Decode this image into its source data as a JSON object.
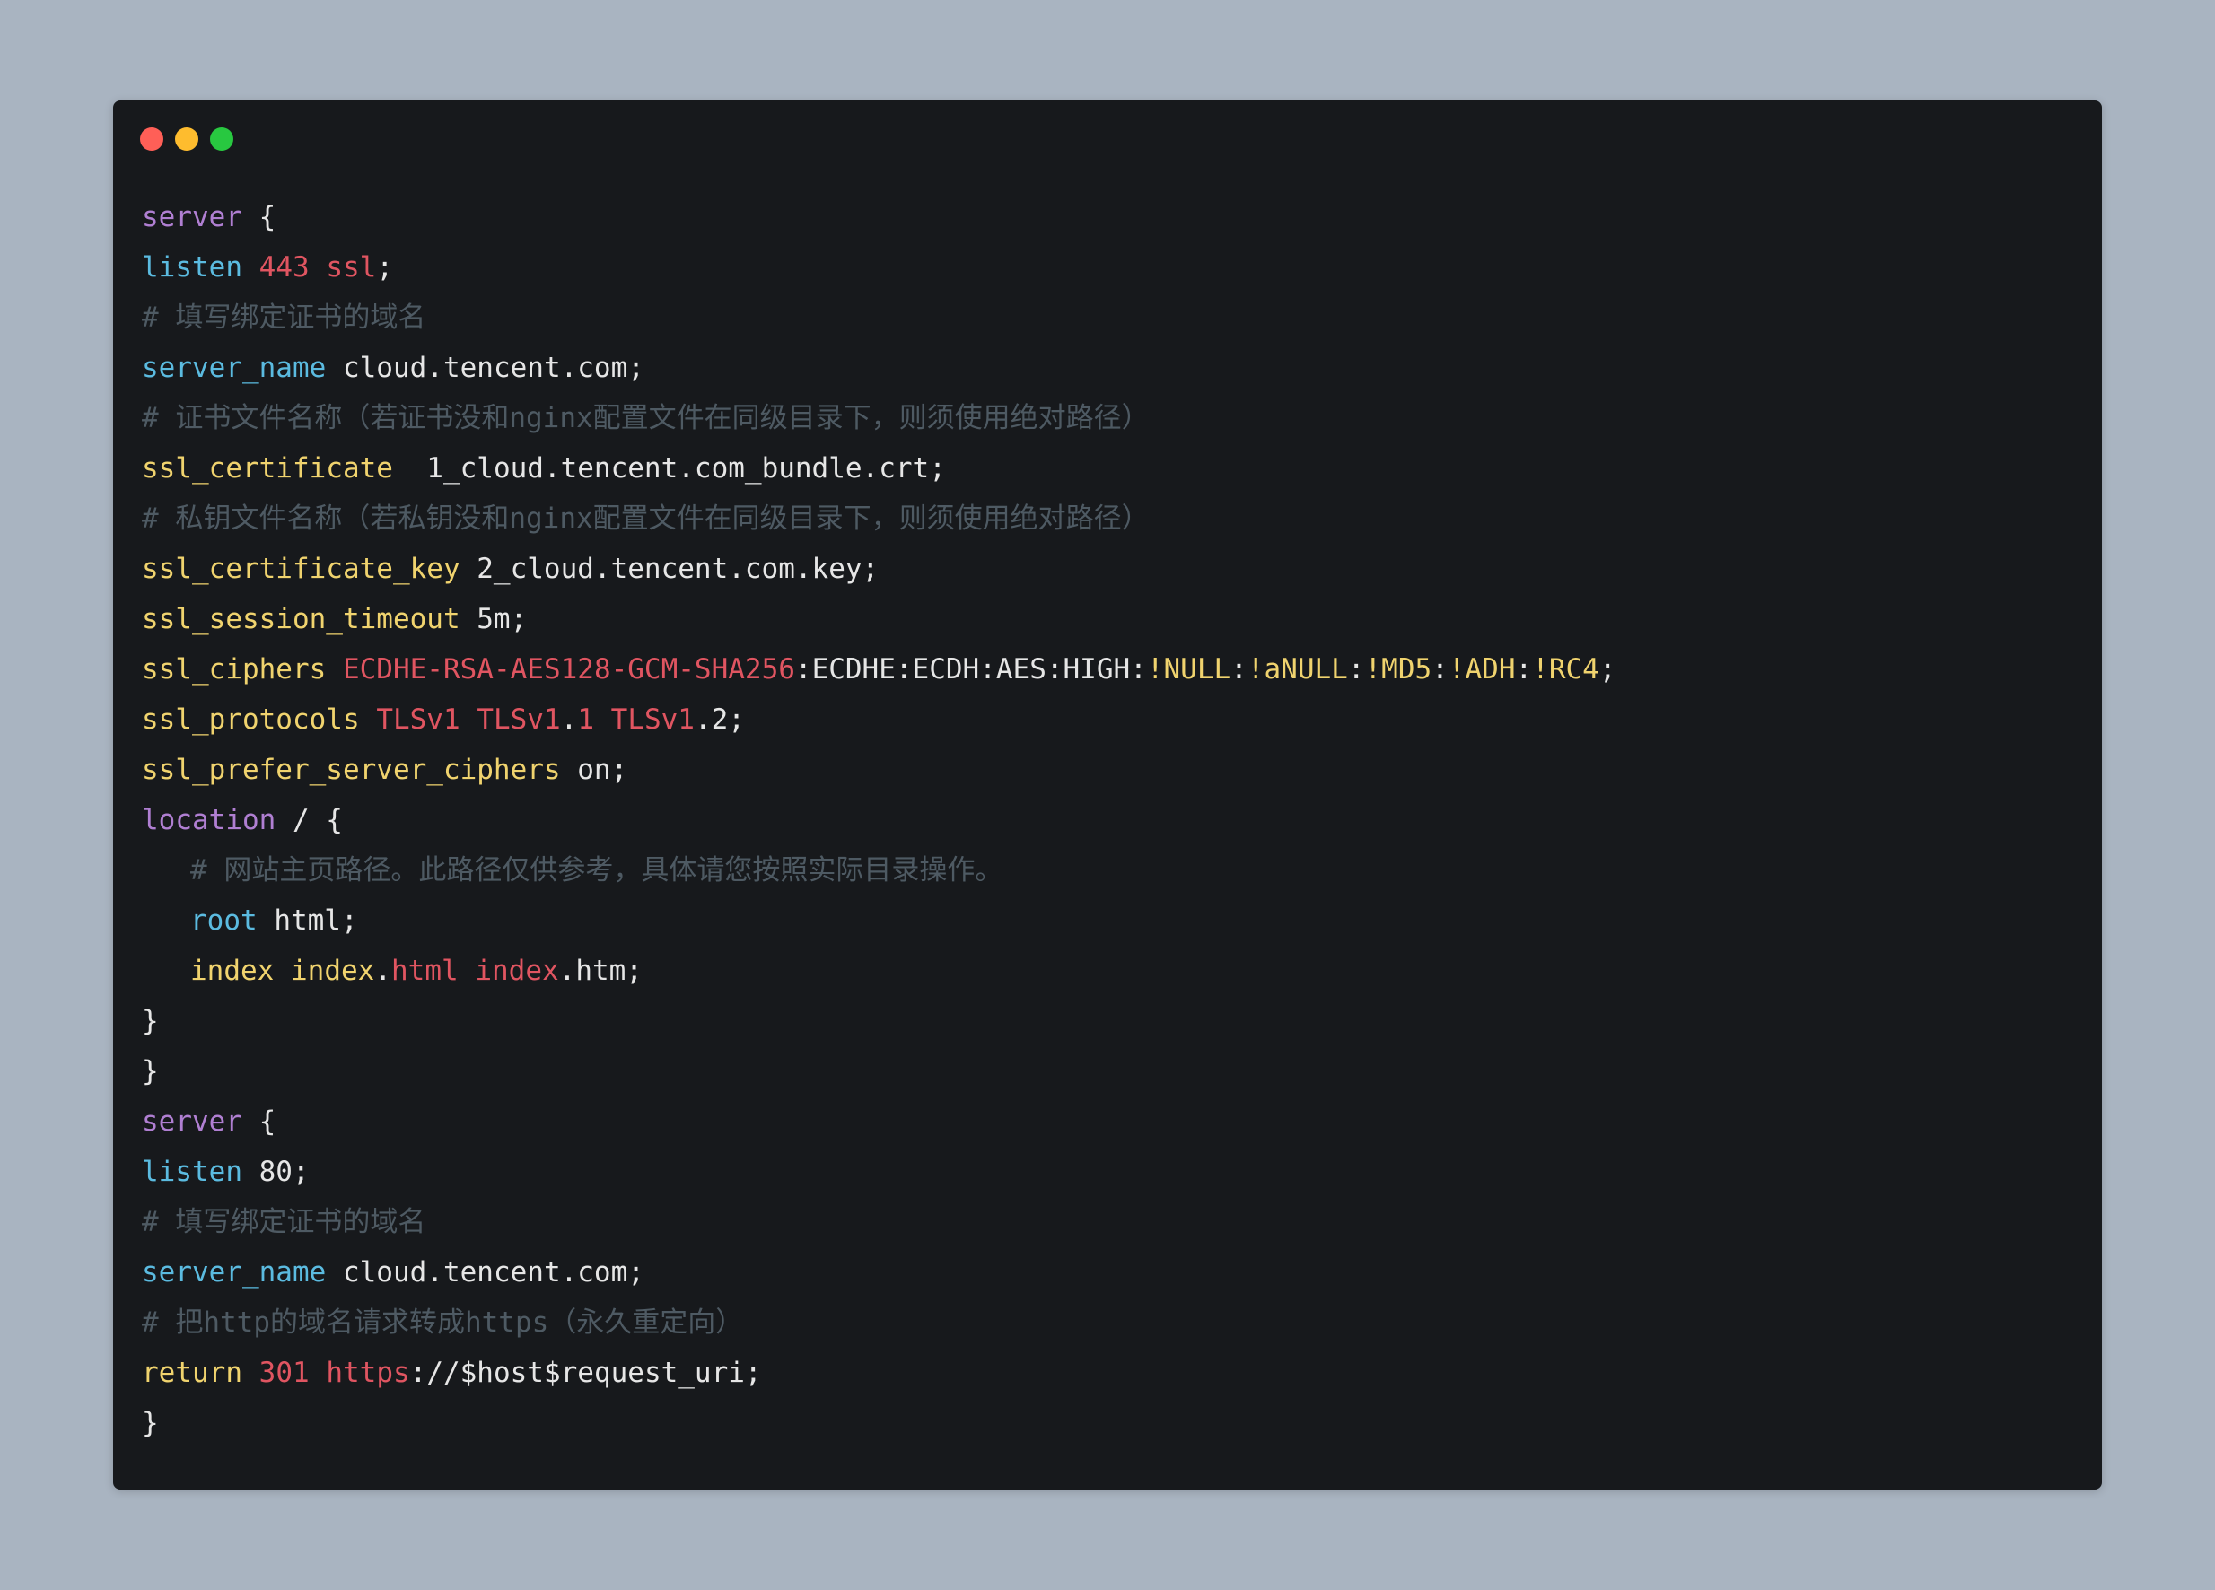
{
  "window": {
    "controls": [
      {
        "name": "close",
        "color": "#ff5f57"
      },
      {
        "name": "minimize",
        "color": "#febc2e"
      },
      {
        "name": "maximize",
        "color": "#28c840"
      }
    ]
  },
  "code": {
    "language": "nginx",
    "lines": [
      {
        "indent": 0,
        "tokens": [
          {
            "t": "server",
            "c": "purple"
          },
          {
            "t": " {",
            "c": "plain"
          }
        ]
      },
      {
        "indent": 0,
        "tokens": [
          {
            "t": "listen",
            "c": "blue"
          },
          {
            "t": " ",
            "c": "plain"
          },
          {
            "t": "443",
            "c": "red"
          },
          {
            "t": " ",
            "c": "plain"
          },
          {
            "t": "ssl",
            "c": "red"
          },
          {
            "t": ";",
            "c": "plain"
          }
        ]
      },
      {
        "indent": 0,
        "tokens": [
          {
            "t": "# 填写绑定证书的域名",
            "c": "comment"
          }
        ]
      },
      {
        "indent": 0,
        "tokens": [
          {
            "t": "server_name",
            "c": "blue"
          },
          {
            "t": " cloud.tencent.com;",
            "c": "plain"
          }
        ]
      },
      {
        "indent": 0,
        "tokens": [
          {
            "t": "# 证书文件名称（若证书没和nginx配置文件在同级目录下，则须使用绝对路径）",
            "c": "comment"
          }
        ]
      },
      {
        "indent": 0,
        "tokens": [
          {
            "t": "ssl_certificate",
            "c": "yellow"
          },
          {
            "t": "  1_cloud.tencent.com_bundle.crt;",
            "c": "plain"
          }
        ]
      },
      {
        "indent": 0,
        "tokens": [
          {
            "t": "# 私钥文件名称（若私钥没和nginx配置文件在同级目录下，则须使用绝对路径）",
            "c": "comment"
          }
        ]
      },
      {
        "indent": 0,
        "tokens": [
          {
            "t": "ssl_certificate_key",
            "c": "yellow"
          },
          {
            "t": " 2_cloud.tencent.com.key;",
            "c": "plain"
          }
        ]
      },
      {
        "indent": 0,
        "tokens": [
          {
            "t": "ssl_session_timeout",
            "c": "yellow"
          },
          {
            "t": " 5m;",
            "c": "plain"
          }
        ]
      },
      {
        "indent": 0,
        "tokens": [
          {
            "t": "ssl_ciphers",
            "c": "yellow"
          },
          {
            "t": " ",
            "c": "plain"
          },
          {
            "t": "ECDHE-RSA-AES128-GCM-SHA256",
            "c": "red"
          },
          {
            "t": ":ECDHE:ECDH:AES:HIGH:",
            "c": "plain"
          },
          {
            "t": "!NULL",
            "c": "yellow"
          },
          {
            "t": ":",
            "c": "plain"
          },
          {
            "t": "!aNULL",
            "c": "yellow"
          },
          {
            "t": ":",
            "c": "plain"
          },
          {
            "t": "!MD5",
            "c": "yellow"
          },
          {
            "t": ":",
            "c": "plain"
          },
          {
            "t": "!ADH",
            "c": "yellow"
          },
          {
            "t": ":",
            "c": "plain"
          },
          {
            "t": "!RC4",
            "c": "yellow"
          },
          {
            "t": ";",
            "c": "plain"
          }
        ]
      },
      {
        "indent": 0,
        "tokens": [
          {
            "t": "ssl_protocols",
            "c": "yellow"
          },
          {
            "t": " ",
            "c": "plain"
          },
          {
            "t": "TLSv1",
            "c": "red"
          },
          {
            "t": " ",
            "c": "plain"
          },
          {
            "t": "TLSv1",
            "c": "red"
          },
          {
            "t": ".",
            "c": "plain"
          },
          {
            "t": "1",
            "c": "red"
          },
          {
            "t": " ",
            "c": "plain"
          },
          {
            "t": "TLSv1",
            "c": "red"
          },
          {
            "t": ".2;",
            "c": "plain"
          }
        ]
      },
      {
        "indent": 0,
        "tokens": [
          {
            "t": "ssl_prefer_server_ciphers",
            "c": "yellow"
          },
          {
            "t": " on;",
            "c": "plain"
          }
        ]
      },
      {
        "indent": 0,
        "tokens": [
          {
            "t": "location",
            "c": "purple"
          },
          {
            "t": " / {",
            "c": "plain"
          }
        ]
      },
      {
        "indent": 1,
        "tokens": [
          {
            "t": "# 网站主页路径。此路径仅供参考，具体请您按照实际目录操作。",
            "c": "comment"
          }
        ]
      },
      {
        "indent": 1,
        "tokens": [
          {
            "t": "root",
            "c": "blue"
          },
          {
            "t": " html;",
            "c": "plain"
          }
        ]
      },
      {
        "indent": 1,
        "tokens": [
          {
            "t": "index",
            "c": "yellow"
          },
          {
            "t": " ",
            "c": "plain"
          },
          {
            "t": "index",
            "c": "yellow"
          },
          {
            "t": ".",
            "c": "plain"
          },
          {
            "t": "html",
            "c": "red"
          },
          {
            "t": " ",
            "c": "plain"
          },
          {
            "t": "index",
            "c": "red"
          },
          {
            "t": ".htm;",
            "c": "plain"
          }
        ]
      },
      {
        "indent": 0,
        "tokens": [
          {
            "t": "}",
            "c": "plain"
          }
        ]
      },
      {
        "indent": 0,
        "tokens": [
          {
            "t": "}",
            "c": "plain"
          }
        ]
      },
      {
        "indent": 0,
        "tokens": [
          {
            "t": "server",
            "c": "purple"
          },
          {
            "t": " {",
            "c": "plain"
          }
        ]
      },
      {
        "indent": 0,
        "tokens": [
          {
            "t": "listen",
            "c": "blue"
          },
          {
            "t": " 80;",
            "c": "plain"
          }
        ]
      },
      {
        "indent": 0,
        "tokens": [
          {
            "t": "# 填写绑定证书的域名",
            "c": "comment"
          }
        ]
      },
      {
        "indent": 0,
        "tokens": [
          {
            "t": "server_name",
            "c": "blue"
          },
          {
            "t": " cloud.tencent.com;",
            "c": "plain"
          }
        ]
      },
      {
        "indent": 0,
        "tokens": [
          {
            "t": "# 把http的域名请求转成https（永久重定向）",
            "c": "comment"
          }
        ]
      },
      {
        "indent": 0,
        "tokens": [
          {
            "t": "return",
            "c": "yellow"
          },
          {
            "t": " ",
            "c": "plain"
          },
          {
            "t": "301",
            "c": "red"
          },
          {
            "t": " ",
            "c": "plain"
          },
          {
            "t": "https",
            "c": "red"
          },
          {
            "t": "://$host$request_uri;",
            "c": "plain"
          }
        ]
      },
      {
        "indent": 0,
        "tokens": [
          {
            "t": "}",
            "c": "plain"
          }
        ]
      }
    ]
  }
}
